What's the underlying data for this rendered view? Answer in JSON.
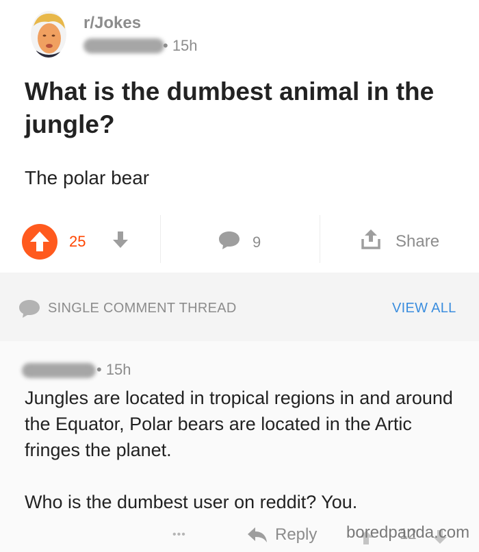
{
  "post": {
    "subreddit": "r/Jokes",
    "time_ago": "• 15h",
    "title": "What is the dumbest animal in the jungle?",
    "body": "The polar bear",
    "score": "25",
    "comment_count": "9",
    "share_label": "Share",
    "upvoted": true,
    "accent_color": "#ff4500"
  },
  "thread_bar": {
    "label": "SINGLE COMMENT THREAD",
    "view_all_label": "VIEW ALL",
    "link_color": "#3a8dde"
  },
  "comment": {
    "time_ago": "• 15h",
    "paragraphs": [
      "Jungles are located in tropical regions in and around the Equator, Polar bears are located in the Artic fringes the planet.",
      "Who is the dumbest user on reddit? You."
    ],
    "more_label": "•••",
    "reply_label": "Reply",
    "score": "12"
  },
  "watermark": "boredpanda.com",
  "icons": [
    "avatar-face",
    "upvote-arrow",
    "downvote-arrow",
    "comment-bubble",
    "share-upload",
    "reply-arrow"
  ]
}
